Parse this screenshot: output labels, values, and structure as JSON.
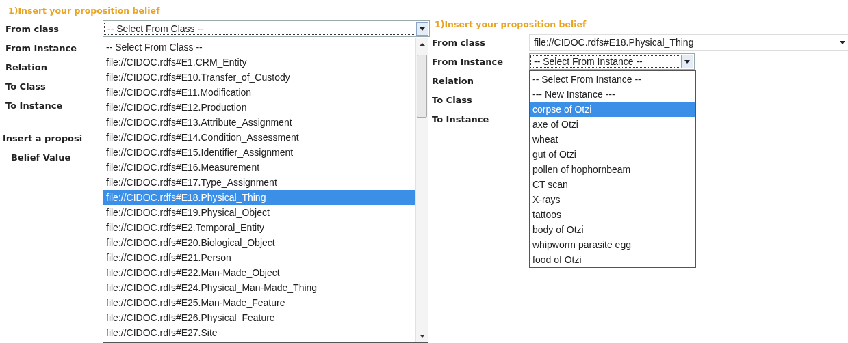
{
  "left_form": {
    "title": "1)Insert your proposition belief",
    "labels": [
      "From class",
      "From Instance",
      "Relation",
      "To Class",
      "To Instance"
    ],
    "proposition_label": "Insert a proposi",
    "belief_label": "Belief Value",
    "from_class_select": {
      "value": "-- Select From Class --",
      "focused": true
    },
    "dropdown": {
      "options": [
        {
          "label": "-- Select From Class --",
          "selected": false
        },
        {
          "label": "file://CIDOC.rdfs#E1.CRM_Entity",
          "selected": false
        },
        {
          "label": "file://CIDOC.rdfs#E10.Transfer_of_Custody",
          "selected": false
        },
        {
          "label": "file://CIDOC.rdfs#E11.Modification",
          "selected": false
        },
        {
          "label": "file://CIDOC.rdfs#E12.Production",
          "selected": false
        },
        {
          "label": "file://CIDOC.rdfs#E13.Attribute_Assignment",
          "selected": false
        },
        {
          "label": "file://CIDOC.rdfs#E14.Condition_Assessment",
          "selected": false
        },
        {
          "label": "file://CIDOC.rdfs#E15.Identifier_Assignment",
          "selected": false
        },
        {
          "label": "file://CIDOC.rdfs#E16.Measurement",
          "selected": false
        },
        {
          "label": "file://CIDOC.rdfs#E17.Type_Assignment",
          "selected": false
        },
        {
          "label": "file://CIDOC.rdfs#E18.Physical_Thing",
          "selected": true
        },
        {
          "label": "file://CIDOC.rdfs#E19.Physical_Object",
          "selected": false
        },
        {
          "label": "file://CIDOC.rdfs#E2.Temporal_Entity",
          "selected": false
        },
        {
          "label": "file://CIDOC.rdfs#E20.Biological_Object",
          "selected": false
        },
        {
          "label": "file://CIDOC.rdfs#E21.Person",
          "selected": false
        },
        {
          "label": "file://CIDOC.rdfs#E22.Man-Made_Object",
          "selected": false
        },
        {
          "label": "file://CIDOC.rdfs#E24.Physical_Man-Made_Thing",
          "selected": false
        },
        {
          "label": "file://CIDOC.rdfs#E25.Man-Made_Feature",
          "selected": false
        },
        {
          "label": "file://CIDOC.rdfs#E26.Physical_Feature",
          "selected": false
        },
        {
          "label": "file://CIDOC.rdfs#E27.Site",
          "selected": false
        }
      ]
    }
  },
  "right_form": {
    "title": "1)Insert your proposition belief",
    "labels": [
      "From class",
      "From Instance",
      "Relation",
      "To Class",
      "To Instance"
    ],
    "from_class_select": {
      "value": "file://CIDOC.rdfs#E18.Physical_Thing"
    },
    "from_instance_select": {
      "value": "-- Select From Instance --",
      "focused": true
    },
    "dropdown": {
      "options": [
        {
          "label": "-- Select From Instance --",
          "selected": false
        },
        {
          "label": "--- New Instance ---",
          "selected": false
        },
        {
          "label": "corpse of Otzi",
          "selected": true
        },
        {
          "label": "axe of Otzi",
          "selected": false
        },
        {
          "label": "wheat",
          "selected": false
        },
        {
          "label": "gut of Otzi",
          "selected": false
        },
        {
          "label": "pollen of hophornbeam",
          "selected": false
        },
        {
          "label": "CT scan",
          "selected": false
        },
        {
          "label": "X-rays",
          "selected": false
        },
        {
          "label": "tattoos",
          "selected": false
        },
        {
          "label": "body of Otzi",
          "selected": false
        },
        {
          "label": "whipworm parasite egg",
          "selected": false
        },
        {
          "label": "food of Otzi",
          "selected": false
        }
      ]
    }
  }
}
